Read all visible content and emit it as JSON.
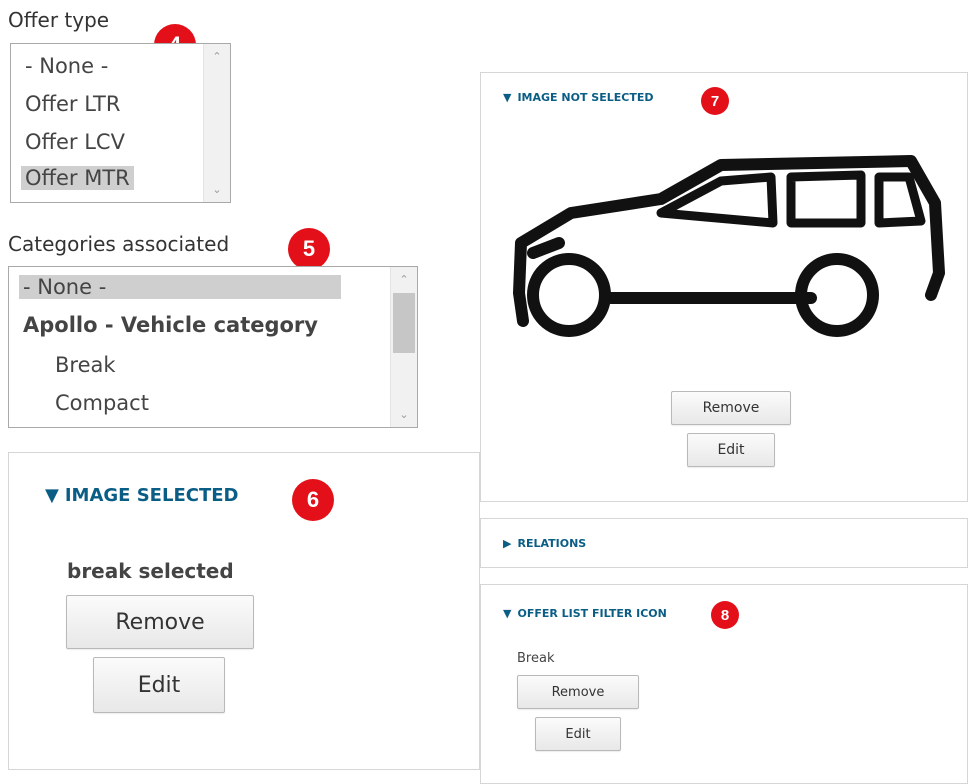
{
  "offer_type": {
    "label": "Offer type",
    "badge": "4",
    "options": [
      "- None -",
      "Offer LTR",
      "Offer LCV",
      "Offer MTR"
    ],
    "selected": "Offer MTR"
  },
  "categories": {
    "label": "Categories associated",
    "badge": "5",
    "options": [
      "- None -",
      "Apollo - Vehicle category",
      "Break",
      "Compact"
    ],
    "selected": "- None -"
  },
  "image_selected": {
    "summary": "IMAGE SELECTED",
    "badge": "6",
    "filename": "break selected",
    "remove_label": "Remove",
    "edit_label": "Edit"
  },
  "image_not_selected": {
    "summary": "IMAGE NOT SELECTED",
    "badge": "7",
    "image_icon": "car-icon",
    "remove_label": "Remove",
    "edit_label": "Edit"
  },
  "relations": {
    "summary": "RELATIONS"
  },
  "offer_list_filter_icon": {
    "summary": "OFFER LIST FILTER ICON",
    "badge": "8",
    "filename": "Break",
    "remove_label": "Remove",
    "edit_label": "Edit"
  },
  "colors": {
    "badge": "#e3101a",
    "summary_link": "#0a5d85",
    "selected_option": "#cfcfcf"
  }
}
